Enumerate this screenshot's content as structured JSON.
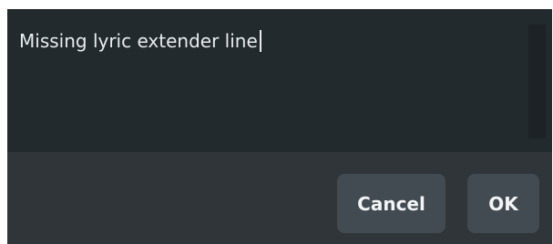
{
  "dialog": {
    "text_field": {
      "value": "Missing lyric extender line"
    },
    "buttons": {
      "cancel_label": "Cancel",
      "ok_label": "OK"
    }
  },
  "colors": {
    "dialog_background": "#2f3538",
    "text_area_background": "#232a2e",
    "button_background": "#424b52",
    "text": "#e8ecef"
  }
}
